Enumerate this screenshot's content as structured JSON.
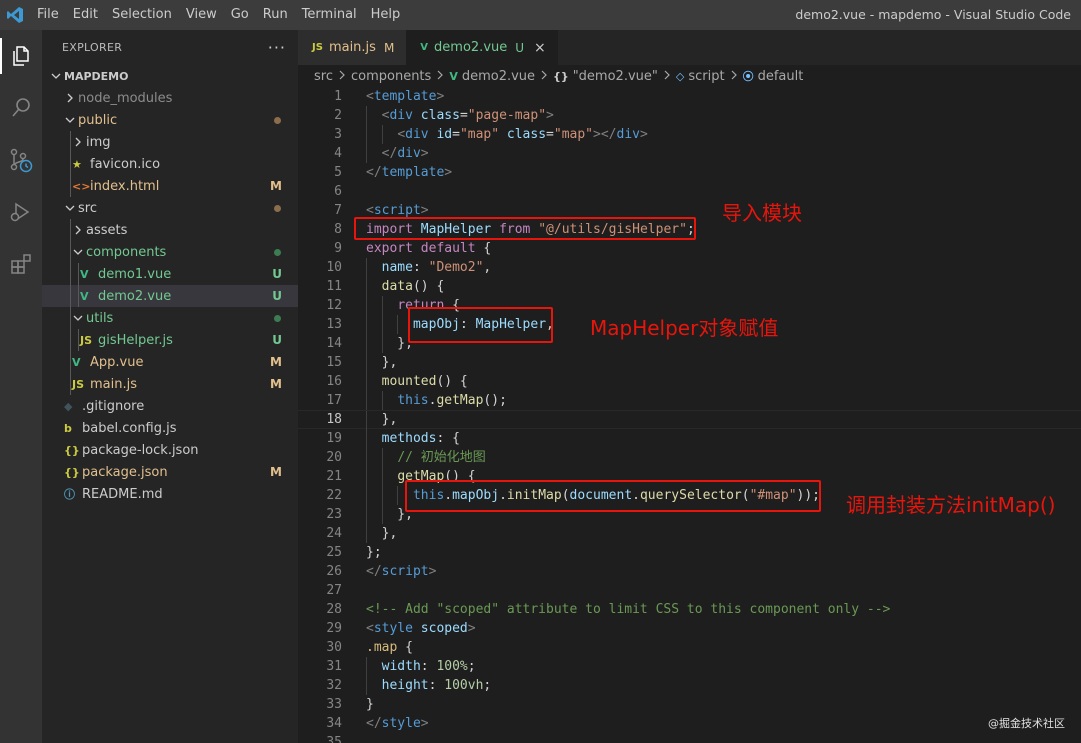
{
  "titlebar": {
    "menu": [
      "File",
      "Edit",
      "Selection",
      "View",
      "Go",
      "Run",
      "Terminal",
      "Help"
    ],
    "window_title": "demo2.vue - mapdemo - Visual Studio Code"
  },
  "activitybar": {
    "icons": [
      "explorer-icon",
      "search-icon",
      "source-control-icon",
      "run-debug-icon",
      "extensions-icon"
    ]
  },
  "sidebar": {
    "header": "EXPLORER",
    "more": "···",
    "project": "MAPDEMO",
    "tree": [
      {
        "label": "node_modules",
        "type": "folder",
        "open": false,
        "depth": 1,
        "color": "#8c8c8c"
      },
      {
        "label": "public",
        "type": "folder",
        "open": true,
        "depth": 1,
        "color": "#e2c08d",
        "dot": "#8c6d4a"
      },
      {
        "label": "img",
        "type": "folder",
        "open": false,
        "depth": 2,
        "color": "#cccccc"
      },
      {
        "label": "favicon.ico",
        "type": "file",
        "icon": "★",
        "iconColor": "#cbcb41",
        "depth": 2,
        "color": "#cccccc"
      },
      {
        "label": "index.html",
        "type": "file",
        "icon": "<>",
        "iconColor": "#e37933",
        "depth": 2,
        "color": "#e2c08d",
        "badge": "M"
      },
      {
        "label": "src",
        "type": "folder",
        "open": true,
        "depth": 1,
        "color": "#cccccc",
        "dot": "#8c6d4a"
      },
      {
        "label": "assets",
        "type": "folder",
        "open": false,
        "depth": 2,
        "color": "#cccccc"
      },
      {
        "label": "components",
        "type": "folder",
        "open": true,
        "depth": 2,
        "color": "#73c991",
        "dot": "#3d7c52"
      },
      {
        "label": "demo1.vue",
        "type": "file",
        "icon": "V",
        "iconColor": "#41b883",
        "depth": 3,
        "color": "#73c991",
        "badge": "U"
      },
      {
        "label": "demo2.vue",
        "type": "file",
        "icon": "V",
        "iconColor": "#41b883",
        "depth": 3,
        "color": "#73c991",
        "badge": "U",
        "selected": true
      },
      {
        "label": "utils",
        "type": "folder",
        "open": true,
        "depth": 2,
        "color": "#73c991",
        "dot": "#3d7c52"
      },
      {
        "label": "gisHelper.js",
        "type": "file",
        "icon": "JS",
        "iconColor": "#cbcb41",
        "depth": 3,
        "color": "#73c991",
        "badge": "U"
      },
      {
        "label": "App.vue",
        "type": "file",
        "icon": "V",
        "iconColor": "#41b883",
        "depth": 2,
        "color": "#e2c08d",
        "badge": "M"
      },
      {
        "label": "main.js",
        "type": "file",
        "icon": "JS",
        "iconColor": "#cbcb41",
        "depth": 2,
        "color": "#e2c08d",
        "badge": "M"
      },
      {
        "label": ".gitignore",
        "type": "file",
        "icon": "◆",
        "iconColor": "#41535b",
        "depth": 1,
        "color": "#cccccc"
      },
      {
        "label": "babel.config.js",
        "type": "file",
        "icon": "b",
        "iconColor": "#cbcb41",
        "depth": 1,
        "color": "#cccccc"
      },
      {
        "label": "package-lock.json",
        "type": "file",
        "icon": "{}",
        "iconColor": "#cbcb41",
        "depth": 1,
        "color": "#cccccc"
      },
      {
        "label": "package.json",
        "type": "file",
        "icon": "{}",
        "iconColor": "#cbcb41",
        "depth": 1,
        "color": "#e2c08d",
        "badge": "M"
      },
      {
        "label": "README.md",
        "type": "file",
        "icon": "ⓘ",
        "iconColor": "#519aba",
        "depth": 1,
        "color": "#cccccc"
      }
    ]
  },
  "tabs": [
    {
      "icon": "JS",
      "iconColor": "#cbcb41",
      "label": "main.js",
      "status": "M",
      "active": false
    },
    {
      "icon": "V",
      "iconColor": "#41b883",
      "label": "demo2.vue",
      "status": "U",
      "active": true,
      "close": "×"
    }
  ],
  "breadcrumb": {
    "items": [
      "src",
      "components",
      "demo2.vue",
      "\"demo2.vue\"",
      "script",
      "default"
    ],
    "icons": [
      "",
      "",
      "V",
      "{}",
      "◇",
      "⦿"
    ]
  },
  "current_line": 18,
  "code": [
    [
      [
        "t-punc",
        "<"
      ],
      [
        "t-tag",
        "template"
      ],
      [
        "t-punc",
        ">"
      ]
    ],
    [
      [
        "t-def",
        "  "
      ],
      [
        "t-punc",
        "<"
      ],
      [
        "t-tag",
        "div"
      ],
      [
        "t-def",
        " "
      ],
      [
        "t-attr",
        "class"
      ],
      [
        "t-def",
        "="
      ],
      [
        "t-str",
        "\"page-map\""
      ],
      [
        "t-punc",
        ">"
      ]
    ],
    [
      [
        "t-def",
        "    "
      ],
      [
        "t-punc",
        "<"
      ],
      [
        "t-tag",
        "div"
      ],
      [
        "t-def",
        " "
      ],
      [
        "t-attr",
        "id"
      ],
      [
        "t-def",
        "="
      ],
      [
        "t-str",
        "\"map\""
      ],
      [
        "t-def",
        " "
      ],
      [
        "t-attr",
        "class"
      ],
      [
        "t-def",
        "="
      ],
      [
        "t-str",
        "\"map\""
      ],
      [
        "t-punc",
        "></"
      ],
      [
        "t-tag",
        "div"
      ],
      [
        "t-punc",
        ">"
      ]
    ],
    [
      [
        "t-def",
        "  "
      ],
      [
        "t-punc",
        "</"
      ],
      [
        "t-tag",
        "div"
      ],
      [
        "t-punc",
        ">"
      ]
    ],
    [
      [
        "t-punc",
        "</"
      ],
      [
        "t-tag",
        "template"
      ],
      [
        "t-punc",
        ">"
      ]
    ],
    [],
    [
      [
        "t-punc",
        "<"
      ],
      [
        "t-tag",
        "script"
      ],
      [
        "t-punc",
        ">"
      ]
    ],
    [
      [
        "t-kw",
        "import"
      ],
      [
        "t-def",
        " "
      ],
      [
        "t-var",
        "MapHelper"
      ],
      [
        "t-def",
        " "
      ],
      [
        "t-kw",
        "from"
      ],
      [
        "t-def",
        " "
      ],
      [
        "t-str",
        "\"@/utils/gisHelper\""
      ],
      [
        "t-def",
        ";"
      ]
    ],
    [
      [
        "t-kw",
        "export"
      ],
      [
        "t-def",
        " "
      ],
      [
        "t-kw",
        "default"
      ],
      [
        "t-def",
        " {"
      ]
    ],
    [
      [
        "t-def",
        "  "
      ],
      [
        "t-var",
        "name"
      ],
      [
        "t-def",
        ": "
      ],
      [
        "t-str",
        "\"Demo2\""
      ],
      [
        "t-def",
        ","
      ]
    ],
    [
      [
        "t-def",
        "  "
      ],
      [
        "t-fn",
        "data"
      ],
      [
        "t-def",
        "() {"
      ]
    ],
    [
      [
        "t-def",
        "    "
      ],
      [
        "t-kw",
        "return"
      ],
      [
        "t-def",
        " {"
      ]
    ],
    [
      [
        "t-def",
        "      "
      ],
      [
        "t-var",
        "mapObj"
      ],
      [
        "t-def",
        ": "
      ],
      [
        "t-var",
        "MapHelper"
      ],
      [
        "t-def",
        ","
      ]
    ],
    [
      [
        "t-def",
        "    },"
      ]
    ],
    [
      [
        "t-def",
        "  },"
      ]
    ],
    [
      [
        "t-def",
        "  "
      ],
      [
        "t-fn",
        "mounted"
      ],
      [
        "t-def",
        "() {"
      ]
    ],
    [
      [
        "t-def",
        "    "
      ],
      [
        "t-blue",
        "this"
      ],
      [
        "t-def",
        "."
      ],
      [
        "t-fn",
        "getMap"
      ],
      [
        "t-def",
        "();"
      ]
    ],
    [
      [
        "t-def",
        "  },"
      ]
    ],
    [
      [
        "t-def",
        "  "
      ],
      [
        "t-var",
        "methods"
      ],
      [
        "t-def",
        ": {"
      ]
    ],
    [
      [
        "t-def",
        "    "
      ],
      [
        "t-com",
        "// 初始化地图"
      ]
    ],
    [
      [
        "t-def",
        "    "
      ],
      [
        "t-fn",
        "getMap"
      ],
      [
        "t-def",
        "() {"
      ]
    ],
    [
      [
        "t-def",
        "      "
      ],
      [
        "t-blue",
        "this"
      ],
      [
        "t-def",
        "."
      ],
      [
        "t-var",
        "mapObj"
      ],
      [
        "t-def",
        "."
      ],
      [
        "t-fn",
        "initMap"
      ],
      [
        "t-def",
        "("
      ],
      [
        "t-var",
        "document"
      ],
      [
        "t-def",
        "."
      ],
      [
        "t-fn",
        "querySelector"
      ],
      [
        "t-def",
        "("
      ],
      [
        "t-str",
        "\"#map\""
      ],
      [
        "t-def",
        "));"
      ]
    ],
    [
      [
        "t-def",
        "    },"
      ]
    ],
    [
      [
        "t-def",
        "  },"
      ]
    ],
    [
      [
        "t-def",
        "};"
      ]
    ],
    [
      [
        "t-punc",
        "</"
      ],
      [
        "t-tag",
        "script"
      ],
      [
        "t-punc",
        ">"
      ]
    ],
    [],
    [
      [
        "t-com",
        "<!-- Add \"scoped\" attribute to limit CSS to this component only -->"
      ]
    ],
    [
      [
        "t-punc",
        "<"
      ],
      [
        "t-tag",
        "style"
      ],
      [
        "t-def",
        " "
      ],
      [
        "t-attr",
        "scoped"
      ],
      [
        "t-punc",
        ">"
      ]
    ],
    [
      [
        "t-cls",
        ".map"
      ],
      [
        "t-def",
        " {"
      ]
    ],
    [
      [
        "t-def",
        "  "
      ],
      [
        "t-var",
        "width"
      ],
      [
        "t-def",
        ": "
      ],
      [
        "t-num",
        "100%"
      ],
      [
        "t-def",
        ";"
      ]
    ],
    [
      [
        "t-def",
        "  "
      ],
      [
        "t-var",
        "height"
      ],
      [
        "t-def",
        ": "
      ],
      [
        "t-num",
        "100vh"
      ],
      [
        "t-def",
        ";"
      ]
    ],
    [
      [
        "t-def",
        "}"
      ]
    ],
    [
      [
        "t-punc",
        "</"
      ],
      [
        "t-tag",
        "style"
      ],
      [
        "t-punc",
        ">"
      ]
    ],
    []
  ],
  "annotations": {
    "import_note": "导入模块",
    "assign_note": "MapHelper对象赋值",
    "call_note": "调用封装方法initMap()"
  },
  "watermark": "@掘金技术社区"
}
